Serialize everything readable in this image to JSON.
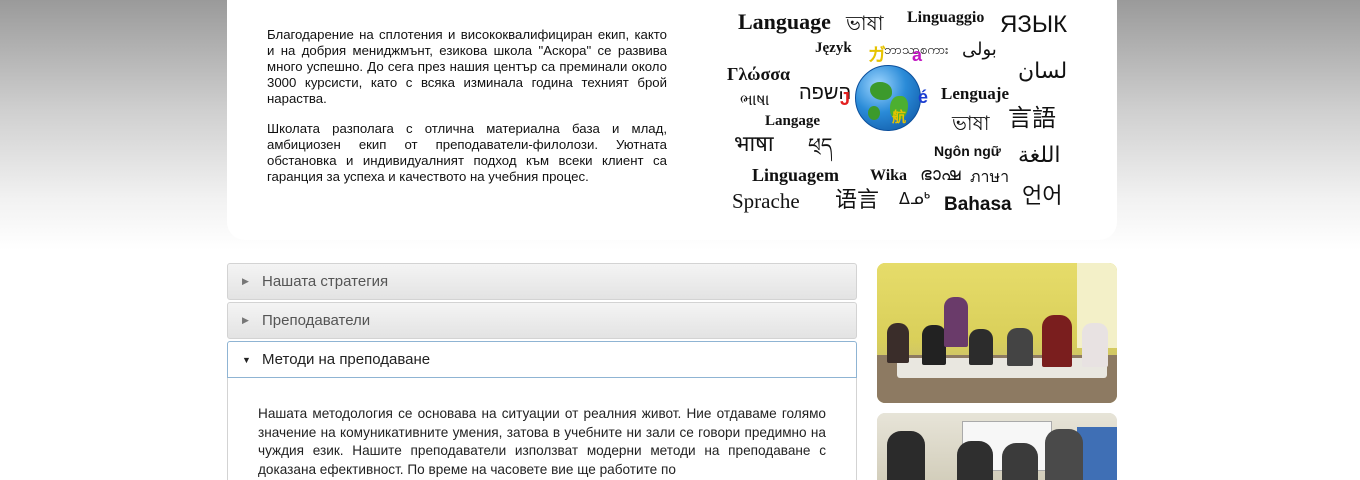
{
  "intro": {
    "paragraph1": "Благодарение на сплотения и висококвалифициран екип, както и на добрия мениджмънт, езикова школа \"Аскора\" се развива много успешно. До сега през нашия център са преминали около 3000 курсисти, като с всяка изминала година техният брой нараства.",
    "paragraph2": "Школата разполага с отлична материална база и млад, амбициозен екип от преподаватели-филолози. Уютната обстановка и индивидуалният подход към всеки клиент са гаранция за успеха и качеството на учебния процес."
  },
  "language_cloud": {
    "words": [
      "Language",
      "ভাষা",
      "Linguaggio",
      "ЯЗЫК",
      "Język",
      "ဘာသာစကား",
      "بولی",
      "Γλώσσα",
      "لسان",
      "ભાષા",
      "השפה",
      "Lenguaje",
      "Langage",
      "ভাষা",
      "言語",
      "भाषा",
      "ཕ྄ད",
      "Ngôn ngữ",
      "اللغة",
      "Linguagem",
      "Wika",
      "ഭാഷ",
      "ภาษา",
      "Sprache",
      "语言",
      "ᐃᓄᒃ",
      "Bahasa",
      "언어"
    ],
    "globe_badges": [
      "ガ",
      "a",
      "J",
      "é",
      "航"
    ]
  },
  "accordion": {
    "sections": [
      {
        "title": "Нашата стратегия",
        "expanded": false
      },
      {
        "title": "Преподаватели",
        "expanded": false
      },
      {
        "title": "Методи на преподаване",
        "expanded": true
      }
    ],
    "active_body": "Нашата методология се основава на ситуации от реалния живот. Ние отдаваме голямо значение на комуникативните умения, затова в учебните ни зали се говори предимно на чуждия език. Нашите преподаватели използват модерни методи на преподаване с доказана ефективност. По време на часовете вие ще работите по"
  },
  "photos": [
    {
      "subject": "classroom-photo"
    },
    {
      "subject": "team-photo"
    }
  ]
}
